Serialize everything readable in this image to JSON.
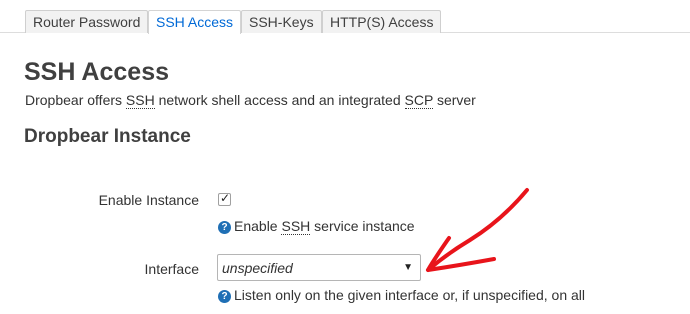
{
  "tabs": [
    {
      "label": "Router Password",
      "active": false
    },
    {
      "label": "SSH Access",
      "active": true
    },
    {
      "label": "SSH-Keys",
      "active": false
    },
    {
      "label": "HTTP(S) Access",
      "active": false
    }
  ],
  "page": {
    "title": "SSH Access",
    "description": {
      "part1": "Dropbear offers ",
      "abbr1": "SSH",
      "part2": " network shell access and an integrated ",
      "abbr2": "SCP",
      "part3": " server"
    }
  },
  "section": {
    "title": "Dropbear Instance"
  },
  "fields": {
    "enable": {
      "label": "Enable Instance",
      "checked": true,
      "check_glyph": "✓",
      "help": {
        "part1": "Enable ",
        "abbr": "SSH",
        "part2": " service instance"
      }
    },
    "interface": {
      "label": "Interface",
      "selected": "unspecified",
      "caret_glyph": "▼",
      "help": "Listen only on the given interface or, if unspecified, on all"
    }
  },
  "help_icon_glyph": "?",
  "annotation": {
    "color": "#e8141b"
  },
  "colors": {
    "active_tab": "#0069d6",
    "help_icon": "#1f6fb5",
    "heading": "#404040"
  }
}
